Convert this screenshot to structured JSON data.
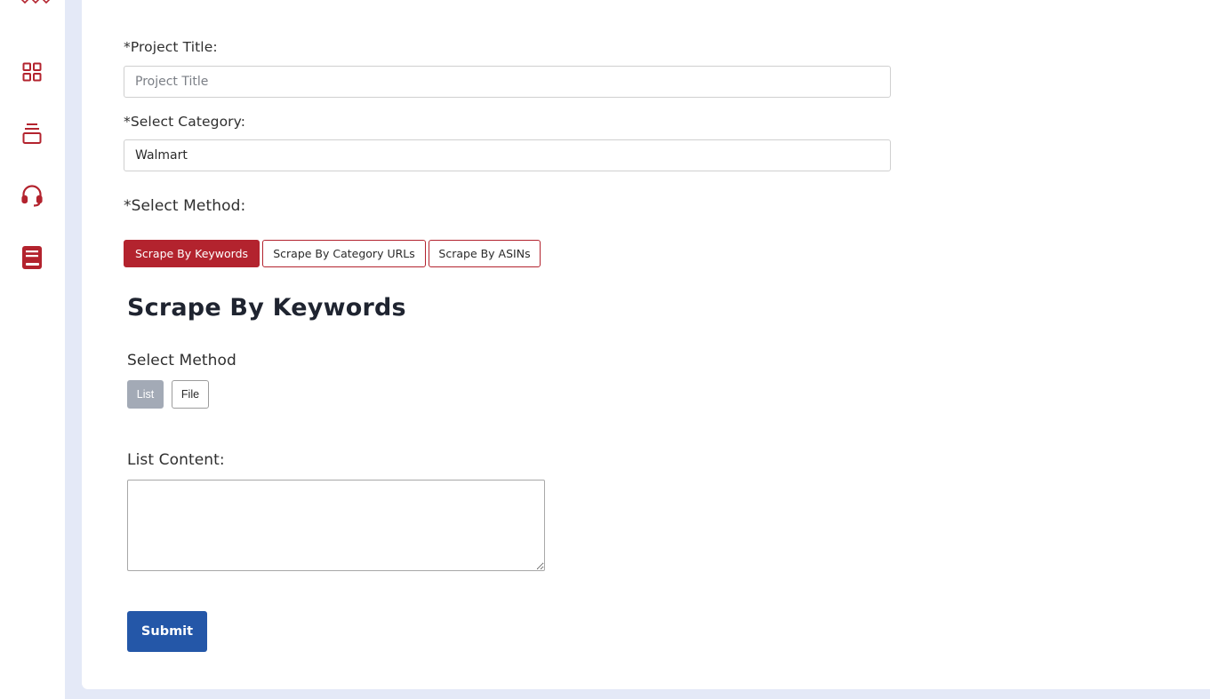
{
  "sidebar": {
    "items": [
      {
        "icon": "grid-icon"
      },
      {
        "icon": "stack-icon"
      },
      {
        "icon": "headset-icon"
      },
      {
        "icon": "book-icon"
      }
    ],
    "accent": "#b3232e"
  },
  "form": {
    "project_title_label": "*Project Title:",
    "project_title_placeholder": "Project Title",
    "project_title_value": "",
    "category_label": "*Select Category:",
    "category_value": "Walmart",
    "method_label": "*Select Method:",
    "methods": [
      {
        "label": "Scrape By Keywords",
        "active": true
      },
      {
        "label": "Scrape By Category URLs",
        "active": false
      },
      {
        "label": "Scrape By ASINs",
        "active": false
      }
    ]
  },
  "section": {
    "heading": "Scrape By Keywords",
    "select_method_label": "Select Method",
    "sub_methods": [
      {
        "label": "List",
        "active": true
      },
      {
        "label": "File",
        "active": false
      }
    ],
    "list_content_label": "List Content:",
    "list_content_value": "",
    "submit_label": "Submit"
  },
  "colors": {
    "accent_red": "#b3232e",
    "submit_blue": "#2457a8",
    "inactive_gray": "#a3aab6",
    "background": "#e4e9f7"
  }
}
